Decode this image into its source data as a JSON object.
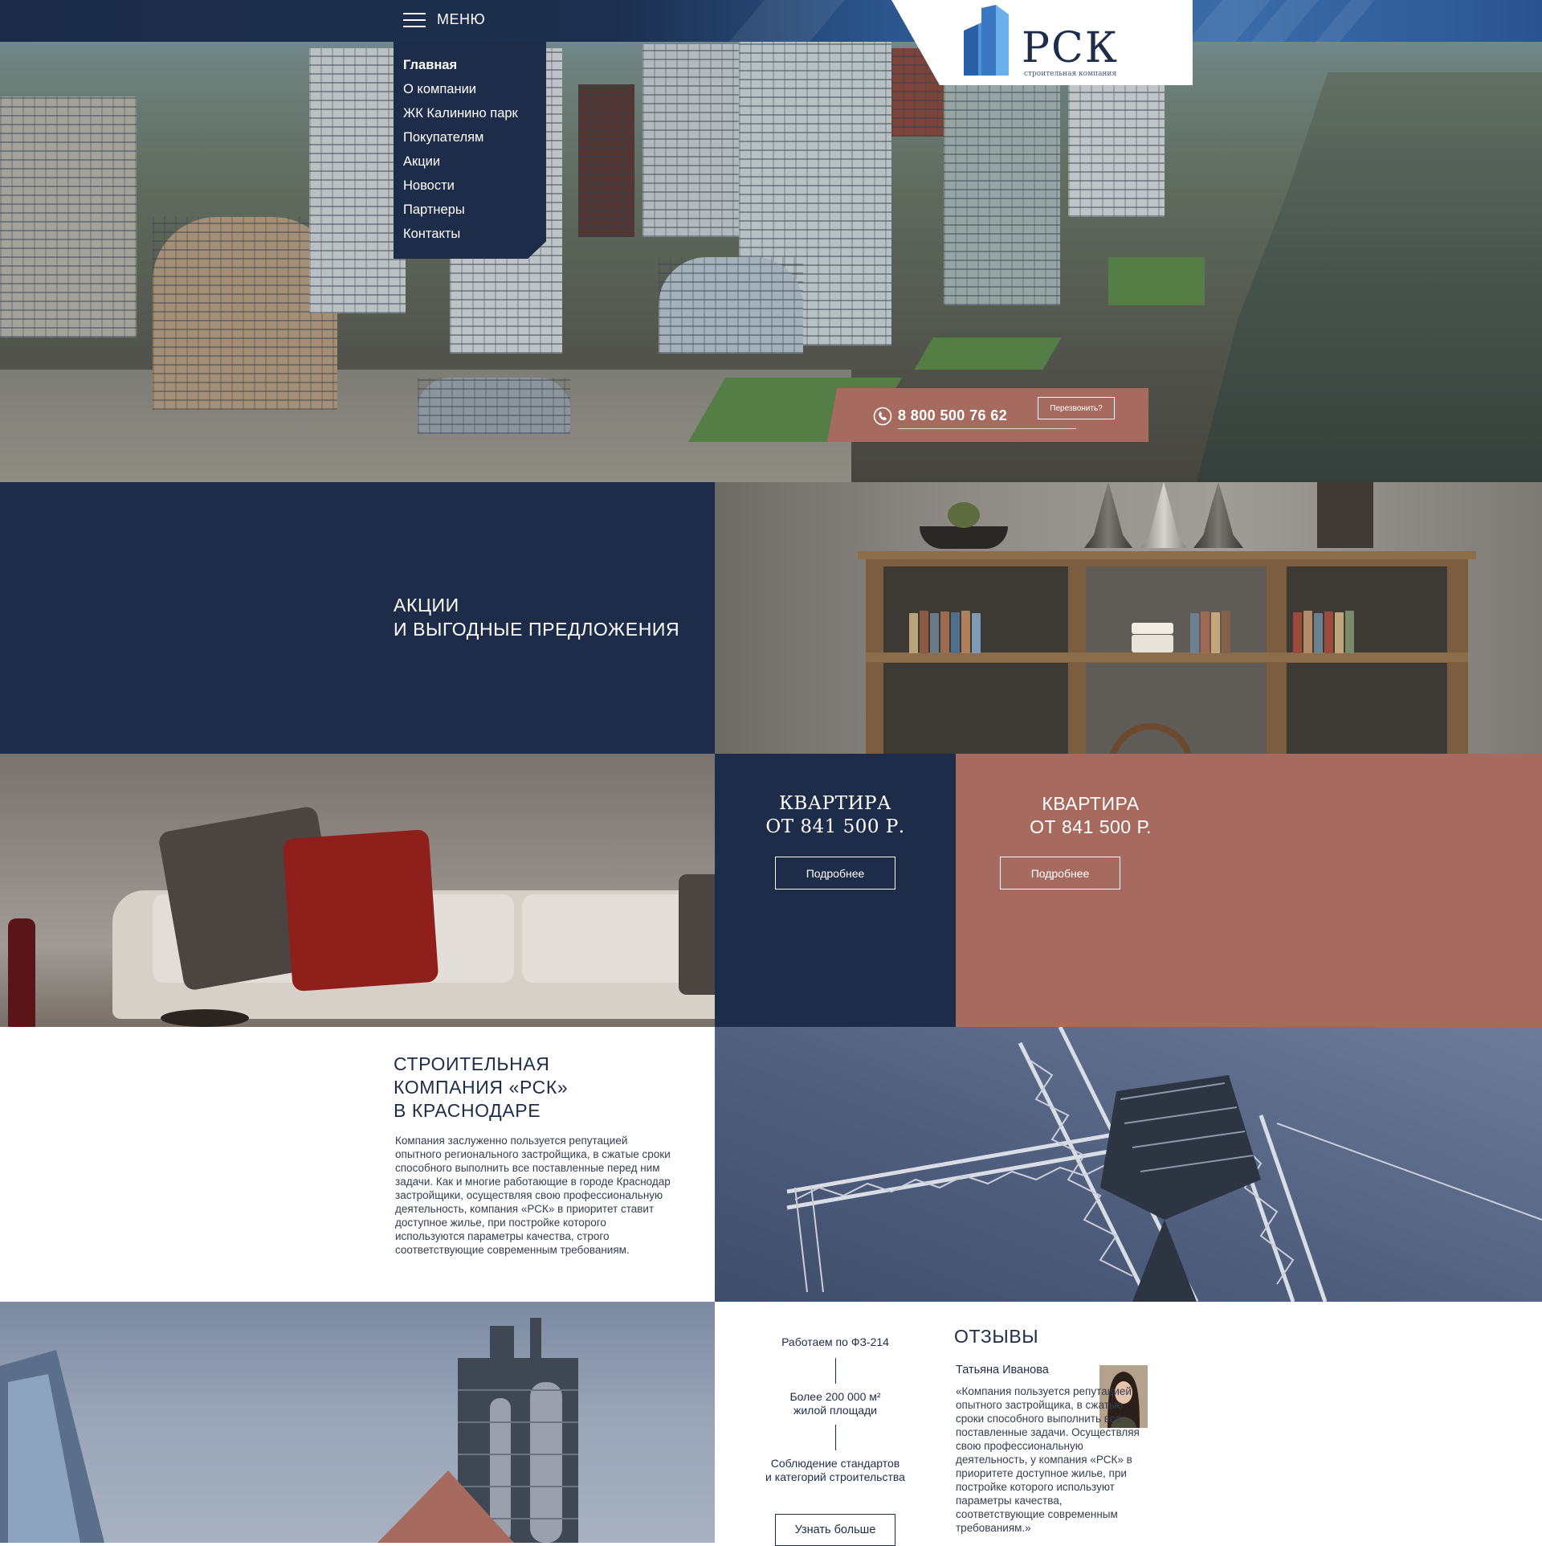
{
  "header": {
    "menu_label": "МЕНЮ",
    "logo_text": "РСК",
    "logo_subtitle": "строительная компания"
  },
  "nav": {
    "items": [
      {
        "label": "Главная",
        "active": true
      },
      {
        "label": "О компании",
        "active": false
      },
      {
        "label": "ЖК Калинино парк",
        "active": false
      },
      {
        "label": "Покупателям",
        "active": false
      },
      {
        "label": "Акции",
        "active": false
      },
      {
        "label": "Новости",
        "active": false
      },
      {
        "label": "Партнеры",
        "active": false
      },
      {
        "label": "Контакты",
        "active": false
      }
    ]
  },
  "contact": {
    "phone": "8 800 500 76 62",
    "callback_label": "Перезвонить?"
  },
  "promo": {
    "title": "АКЦИИ\nИ ВЫГОДНЫЕ ПРЕДЛОЖЕНИЯ"
  },
  "offers": [
    {
      "title": "КВАРТИРА\nОТ 841 500 Р.",
      "button_label": "Подробнее"
    },
    {
      "title": "КВАРТИРА\nОТ 841 500 Р.",
      "button_label": "Подробнее"
    }
  ],
  "about": {
    "heading": "СТРОИТЕЛЬНАЯ\nКОМПАНИЯ «РСК»\nВ КРАСНОДАРЕ",
    "text": "Компания заслуженно пользуется репутацией опытного регионального застройщика, в сжатые сроки способного выполнить все поставленные перед ним задачи. Как и многие работающие в городе Краснодар застройщики, осуществляя свою профессиональную деятельность, компания «РСК» в приоритет ставит доступное жилье, при постройке которого используются параметры качества, строго соответствующие современным требованиям."
  },
  "features": {
    "items": [
      "Работаем по ФЗ-214",
      "Более 200 000 м²\nжилой площади",
      "Соблюдение стандартов\nи категорий строительства"
    ],
    "button_label": "Узнать больше"
  },
  "reviews": {
    "title": "ОТЗЫВЫ",
    "name": "Татьяна Иванова",
    "text": "«Компания пользуется репутацией опытного застройщика, в сжатые сроки способного выполнить все поставленные задачи. Осуществляя свою профессиональную деятельность, у компания «РСК» в приоритете доступное жилье, при постройке которого используют параметры качества, соответствующие современным требованиям.»"
  },
  "colors": {
    "navy": "#1d2d49",
    "terracotta": "#a76a5e",
    "brand_blue": "#3a78c2"
  },
  "icons": {
    "menu": "hamburger-icon",
    "phone": "phone-icon",
    "logo": "building-logo-icon"
  }
}
